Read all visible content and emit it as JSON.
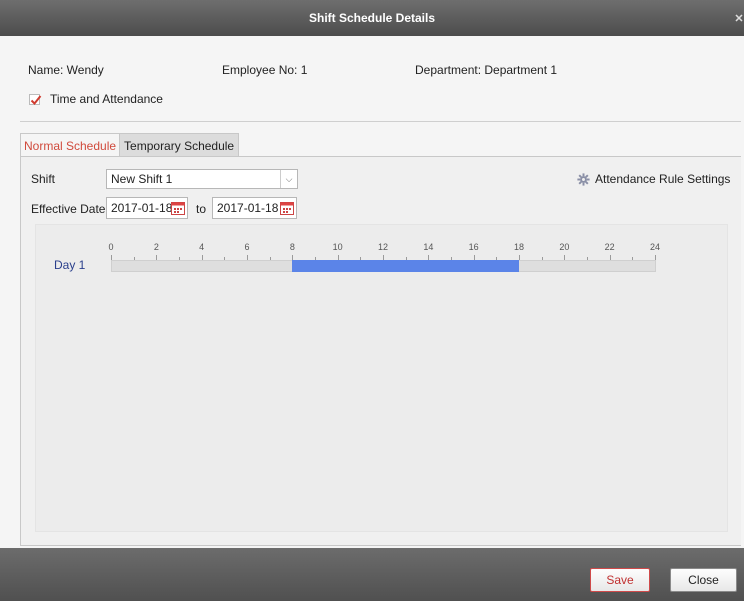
{
  "dialog": {
    "title": "Shift Schedule Details"
  },
  "employee": {
    "name": "Name: Wendy",
    "employee_no": "Employee No: 1",
    "department": "Department: Department 1"
  },
  "time_attendance": {
    "label": "Time and Attendance",
    "checked": true
  },
  "tabs": [
    {
      "label": "Normal Schedule",
      "active": true
    },
    {
      "label": "Temporary Schedule",
      "active": false
    }
  ],
  "form": {
    "shift_label": "Shift",
    "shift_value": "New Shift 1",
    "effective_label": "Effective Date",
    "start_date": "2017-01-18",
    "to_label": "to",
    "end_date": "2017-01-18",
    "rule_settings": "Attendance Rule Settings"
  },
  "timeline": {
    "tick_labels": [
      "0",
      "2",
      "4",
      "6",
      "8",
      "10",
      "12",
      "14",
      "16",
      "18",
      "20",
      "22",
      "24"
    ],
    "day_label": "Day 1",
    "range_start_hour": 8,
    "range_end_hour": 18,
    "max_hour": 24,
    "bar_color": "#5b84e8"
  },
  "footer": {
    "save": "Save",
    "close": "Close"
  },
  "colors": {
    "accent_red": "#d04a3c",
    "day_blue": "#2a3f8c"
  }
}
